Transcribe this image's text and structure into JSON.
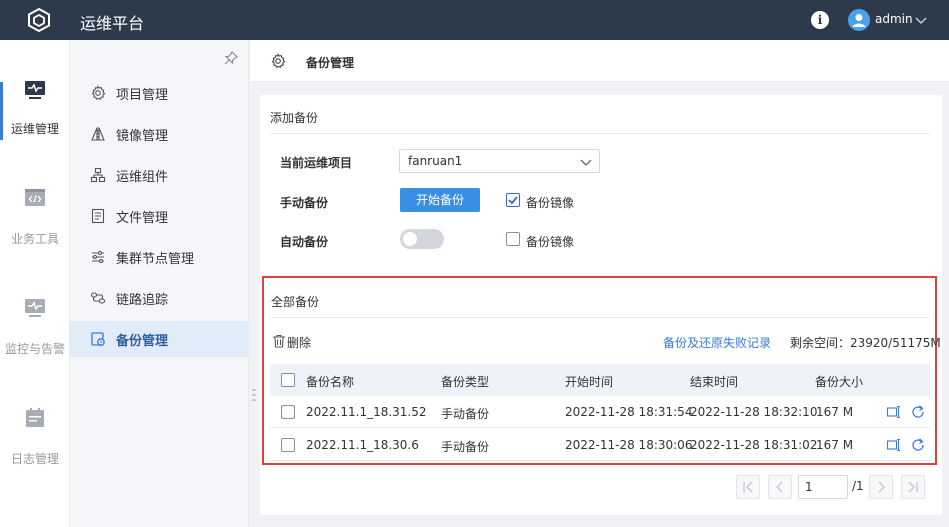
{
  "app": {
    "title": "运维平台"
  },
  "user": {
    "name": "admin"
  },
  "rail": {
    "items": [
      {
        "label": "运维管理",
        "icon": "monitor-pulse-icon",
        "active": true
      },
      {
        "label": "业务工具",
        "icon": "code-window-icon",
        "active": false
      },
      {
        "label": "监控与告警",
        "icon": "monitor-alert-icon",
        "active": false
      },
      {
        "label": "日志管理",
        "icon": "calendar-log-icon",
        "active": false
      }
    ]
  },
  "submenu": {
    "items": [
      {
        "label": "项目管理",
        "icon": "gear-icon"
      },
      {
        "label": "镜像管理",
        "icon": "mirror-icon"
      },
      {
        "label": "运维组件",
        "icon": "component-tree-icon"
      },
      {
        "label": "文件管理",
        "icon": "file-icon"
      },
      {
        "label": "集群节点管理",
        "icon": "sliders-icon"
      },
      {
        "label": "链路追踪",
        "icon": "trace-icon"
      },
      {
        "label": "备份管理",
        "icon": "backup-icon",
        "active": true
      }
    ]
  },
  "page": {
    "title": "备份管理"
  },
  "add_backup": {
    "section_title": "添加备份",
    "project_label": "当前运维项目",
    "project_value": "fanruan1",
    "manual_label": "手动备份",
    "start_button": "开始备份",
    "manual_mirror_label": "备份镜像",
    "manual_mirror_checked": true,
    "auto_label": "自动备份",
    "auto_enabled": false,
    "auto_mirror_label": "备份镜像",
    "auto_mirror_checked": false
  },
  "all_backups": {
    "section_title": "全部备份",
    "delete_label": "删除",
    "failure_log_link": "备份及还原失败记录",
    "space_label": "剩余空间：23920/51175M",
    "columns": [
      "备份名称",
      "备份类型",
      "开始时间",
      "结束时间",
      "备份大小"
    ],
    "rows": [
      {
        "name": "2022.11.1_18.31.52",
        "type": "手动备份",
        "start": "2022-11-28 18:31:54",
        "end": "2022-11-28 18:32:10",
        "size": "167 M"
      },
      {
        "name": "2022.11.1_18.30.6",
        "type": "手动备份",
        "start": "2022-11-28 18:30:06",
        "end": "2022-11-28 18:31:02",
        "size": "167 M"
      }
    ]
  },
  "pagination": {
    "current": "1",
    "total": "/1"
  },
  "colors": {
    "topbar": "#2d3a4b",
    "accent": "#3a8ee6",
    "highlight_frame": "#e0403c"
  }
}
